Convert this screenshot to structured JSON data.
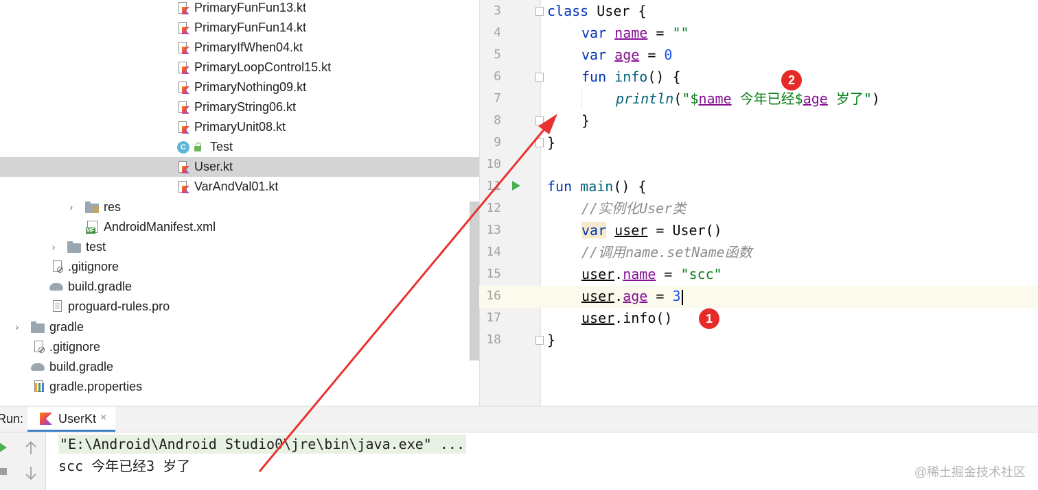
{
  "tree": {
    "items": [
      {
        "label": "PrimaryFunFun13.kt",
        "icon": "kotlin-file-icon"
      },
      {
        "label": "PrimaryFunFun14.kt",
        "icon": "kotlin-file-icon"
      },
      {
        "label": "PrimaryIfWhen04.kt",
        "icon": "kotlin-file-icon"
      },
      {
        "label": "PrimaryLoopControl15.kt",
        "icon": "kotlin-file-icon"
      },
      {
        "label": "PrimaryNothing09.kt",
        "icon": "kotlin-file-icon"
      },
      {
        "label": "PrimaryString06.kt",
        "icon": "kotlin-file-icon"
      },
      {
        "label": "PrimaryUnit08.kt",
        "icon": "kotlin-file-icon"
      },
      {
        "label": "Test",
        "icon": "class-icon"
      },
      {
        "label": "User.kt",
        "icon": "kotlin-file-icon",
        "selected": true
      },
      {
        "label": "VarAndVal01.kt",
        "icon": "kotlin-file-icon"
      },
      {
        "label": "res",
        "icon": "res-folder-icon"
      },
      {
        "label": "AndroidManifest.xml",
        "icon": "manifest-icon"
      },
      {
        "label": "test",
        "icon": "folder-icon"
      },
      {
        "label": ".gitignore",
        "icon": "ignored-file-icon"
      },
      {
        "label": "build.gradle",
        "icon": "gradle-icon"
      },
      {
        "label": "proguard-rules.pro",
        "icon": "text-file-icon"
      },
      {
        "label": "gradle",
        "icon": "folder-icon"
      },
      {
        "label": ".gitignore",
        "icon": "ignored-file-icon"
      },
      {
        "label": "build.gradle",
        "icon": "gradle-icon"
      },
      {
        "label": "gradle.properties",
        "icon": "properties-icon"
      }
    ]
  },
  "editor": {
    "line_numbers": [
      "3",
      "4",
      "5",
      "6",
      "7",
      "8",
      "9",
      "10",
      "11",
      "12",
      "13",
      "14",
      "15",
      "16",
      "17",
      "18"
    ],
    "lines": {
      "l3": {
        "kw": "class",
        "rest": " User {"
      },
      "l4": {
        "kw": "var",
        "prop": "name",
        "op": " = ",
        "str": "\"\""
      },
      "l5": {
        "kw": "var",
        "prop": "age",
        "op": " = ",
        "num": "0"
      },
      "l6": {
        "kw": "fun",
        "fn": "info",
        "rest": "() {"
      },
      "l7": {
        "fn": "println",
        "p1": "(",
        "str1": "\"$",
        "prop1": "name",
        "str2": " 今年已经$",
        "prop2": "age",
        "str3": " 岁了\"",
        "p2": ")"
      },
      "l8": {
        "rest": "}"
      },
      "l9": {
        "rest": "}"
      },
      "l11": {
        "kw": "fun",
        "fn": "main",
        "rest": "() {"
      },
      "l12": {
        "cmt": "//实例化User类"
      },
      "l13": {
        "kw": "var",
        "var": "user",
        "rest": " = User()"
      },
      "l14": {
        "cmt": "//调用name.setName函数"
      },
      "l15": {
        "var": "user",
        "dot": ".",
        "prop": "name",
        "op": " = ",
        "str": "\"scc\""
      },
      "l16": {
        "var": "user",
        "dot": ".",
        "prop": "age",
        "op": " = ",
        "num": "3"
      },
      "l17": {
        "var": "user",
        "rest": ".info()"
      },
      "l18": {
        "rest": "}"
      }
    }
  },
  "annotations": {
    "badge1": "1",
    "badge2": "2",
    "arrow_color": "#e8322f"
  },
  "run": {
    "label": "Run:",
    "tab": "UserKt",
    "close": "×",
    "command": "\"E:\\Android\\Android Studio0\\jre\\bin\\java.exe\" ...",
    "output": "scc 今年已经3 岁了"
  },
  "watermark": "@稀土掘金技术社区",
  "colors": {
    "keyword": "#0033b3",
    "property": "#871094",
    "string": "#067d17",
    "number": "#1750eb",
    "comment": "#8c8c8c",
    "selection": "#d5d5d5",
    "badge": "#e52a28"
  }
}
